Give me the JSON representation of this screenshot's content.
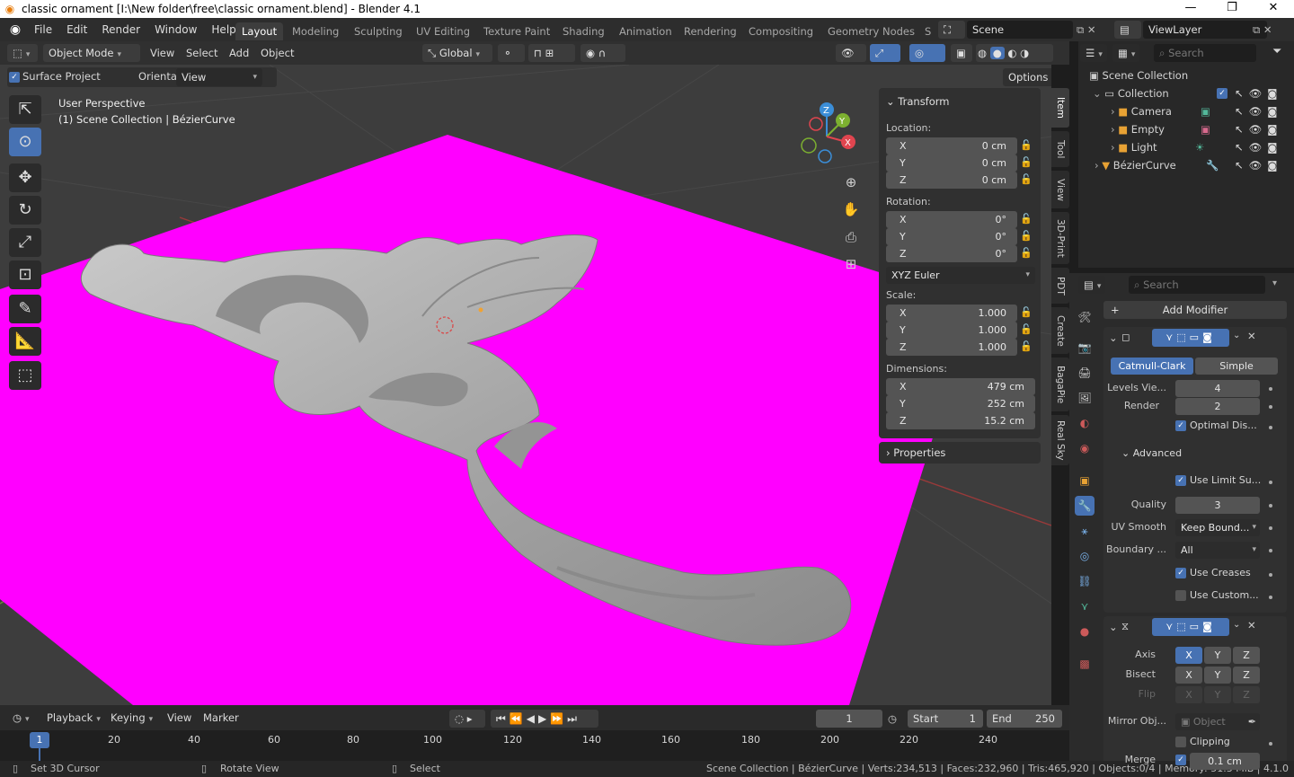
{
  "titlebar": {
    "title": "classic ornament [I:\\New folder\\free\\classic ornament.blend] - Blender 4.1",
    "minimize": "—",
    "maximize": "❐",
    "close": "✕"
  },
  "menu": [
    "File",
    "Edit",
    "Render",
    "Window",
    "Help"
  ],
  "workspaces": [
    "Layout",
    "Modeling",
    "Sculpting",
    "UV Editing",
    "Texture Paint",
    "Shading",
    "Animation",
    "Rendering",
    "Compositing",
    "Geometry Nodes",
    "S"
  ],
  "scene": {
    "label": "Scene",
    "viewlayer": "ViewLayer"
  },
  "vp_header": {
    "mode": "Object Mode",
    "menus": [
      "View",
      "Select",
      "Add",
      "Object"
    ],
    "transform_orientation": "Global"
  },
  "tool_header": {
    "surface_project": "Surface Project",
    "orientation_label": "Orientation:",
    "orientation_value": "View",
    "options": "Options"
  },
  "overlay": {
    "perspective": "User Perspective",
    "collection_info": "(1) Scene Collection | BézierCurve"
  },
  "gizmo": {
    "x": "X",
    "y": "Y",
    "z": "Z"
  },
  "npanel": {
    "transform_title": "Transform",
    "location_label": "Location:",
    "location": [
      {
        "k": "X",
        "v": "0 cm"
      },
      {
        "k": "Y",
        "v": "0 cm"
      },
      {
        "k": "Z",
        "v": "0 cm"
      }
    ],
    "rotation_label": "Rotation:",
    "rotation": [
      {
        "k": "X",
        "v": "0°"
      },
      {
        "k": "Y",
        "v": "0°"
      },
      {
        "k": "Z",
        "v": "0°"
      }
    ],
    "rotation_mode": "XYZ Euler",
    "scale_label": "Scale:",
    "scale": [
      {
        "k": "X",
        "v": "1.000"
      },
      {
        "k": "Y",
        "v": "1.000"
      },
      {
        "k": "Z",
        "v": "1.000"
      }
    ],
    "dimensions_label": "Dimensions:",
    "dimensions": [
      {
        "k": "X",
        "v": "479 cm"
      },
      {
        "k": "Y",
        "v": "252 cm"
      },
      {
        "k": "Z",
        "v": "15.2 cm"
      }
    ],
    "properties_title": "Properties"
  },
  "vtabs": [
    "Item",
    "Tool",
    "View",
    "3D-Print",
    "PDT",
    "Create",
    "BagaPie",
    "Real Sky"
  ],
  "outliner": {
    "search_placeholder": "Search",
    "scene_collection": "Scene Collection",
    "collection": "Collection",
    "items": [
      "Camera",
      "Empty",
      "Light",
      "BézierCurve"
    ]
  },
  "properties": {
    "search_placeholder": "Search",
    "add_modifier": "Add Modifier",
    "subsurf": {
      "tab_catmull": "Catmull-Clark",
      "tab_simple": "Simple",
      "levels_label": "Levels Vie...",
      "levels": "4",
      "render_label": "Render",
      "render": "2",
      "optimal_display": "Optimal Dis...",
      "advanced": "Advanced",
      "use_limit": "Use Limit Su...",
      "quality_label": "Quality",
      "quality": "3",
      "uv_smooth_label": "UV Smooth",
      "uv_smooth": "Keep Bound...",
      "boundary_label": "Boundary ...",
      "boundary": "All",
      "use_creases": "Use Creases",
      "use_custom": "Use Custom..."
    },
    "mirror": {
      "axis_label": "Axis",
      "bisect_label": "Bisect",
      "flip_label": "Flip",
      "x": "X",
      "y": "Y",
      "z": "Z",
      "mirror_obj_label": "Mirror Obj...",
      "mirror_obj_placeholder": "Object",
      "clipping": "Clipping",
      "merge_label": "Merge",
      "merge_value": "0.1 cm"
    }
  },
  "timeline": {
    "menus": [
      "Playback",
      "Keying",
      "View",
      "Marker"
    ],
    "current_frame": "1",
    "start_label": "Start",
    "start": "1",
    "end_label": "End",
    "end": "250",
    "ruler": [
      "1",
      "20",
      "40",
      "60",
      "80",
      "100",
      "120",
      "140",
      "160",
      "180",
      "200",
      "220",
      "240"
    ]
  },
  "status": {
    "left1": "Set 3D Cursor",
    "left2": "Rotate View",
    "left3": "Select",
    "right": "Scene Collection | BézierCurve | Verts:234,513 | Faces:232,960 | Tris:465,920 | Objects:0/4 | Memory: 51.3 MiB | 4.1.0"
  },
  "colors": {
    "ground": "#ff00ff",
    "accent": "#4772b3",
    "mesh": "#a9a9a9"
  }
}
